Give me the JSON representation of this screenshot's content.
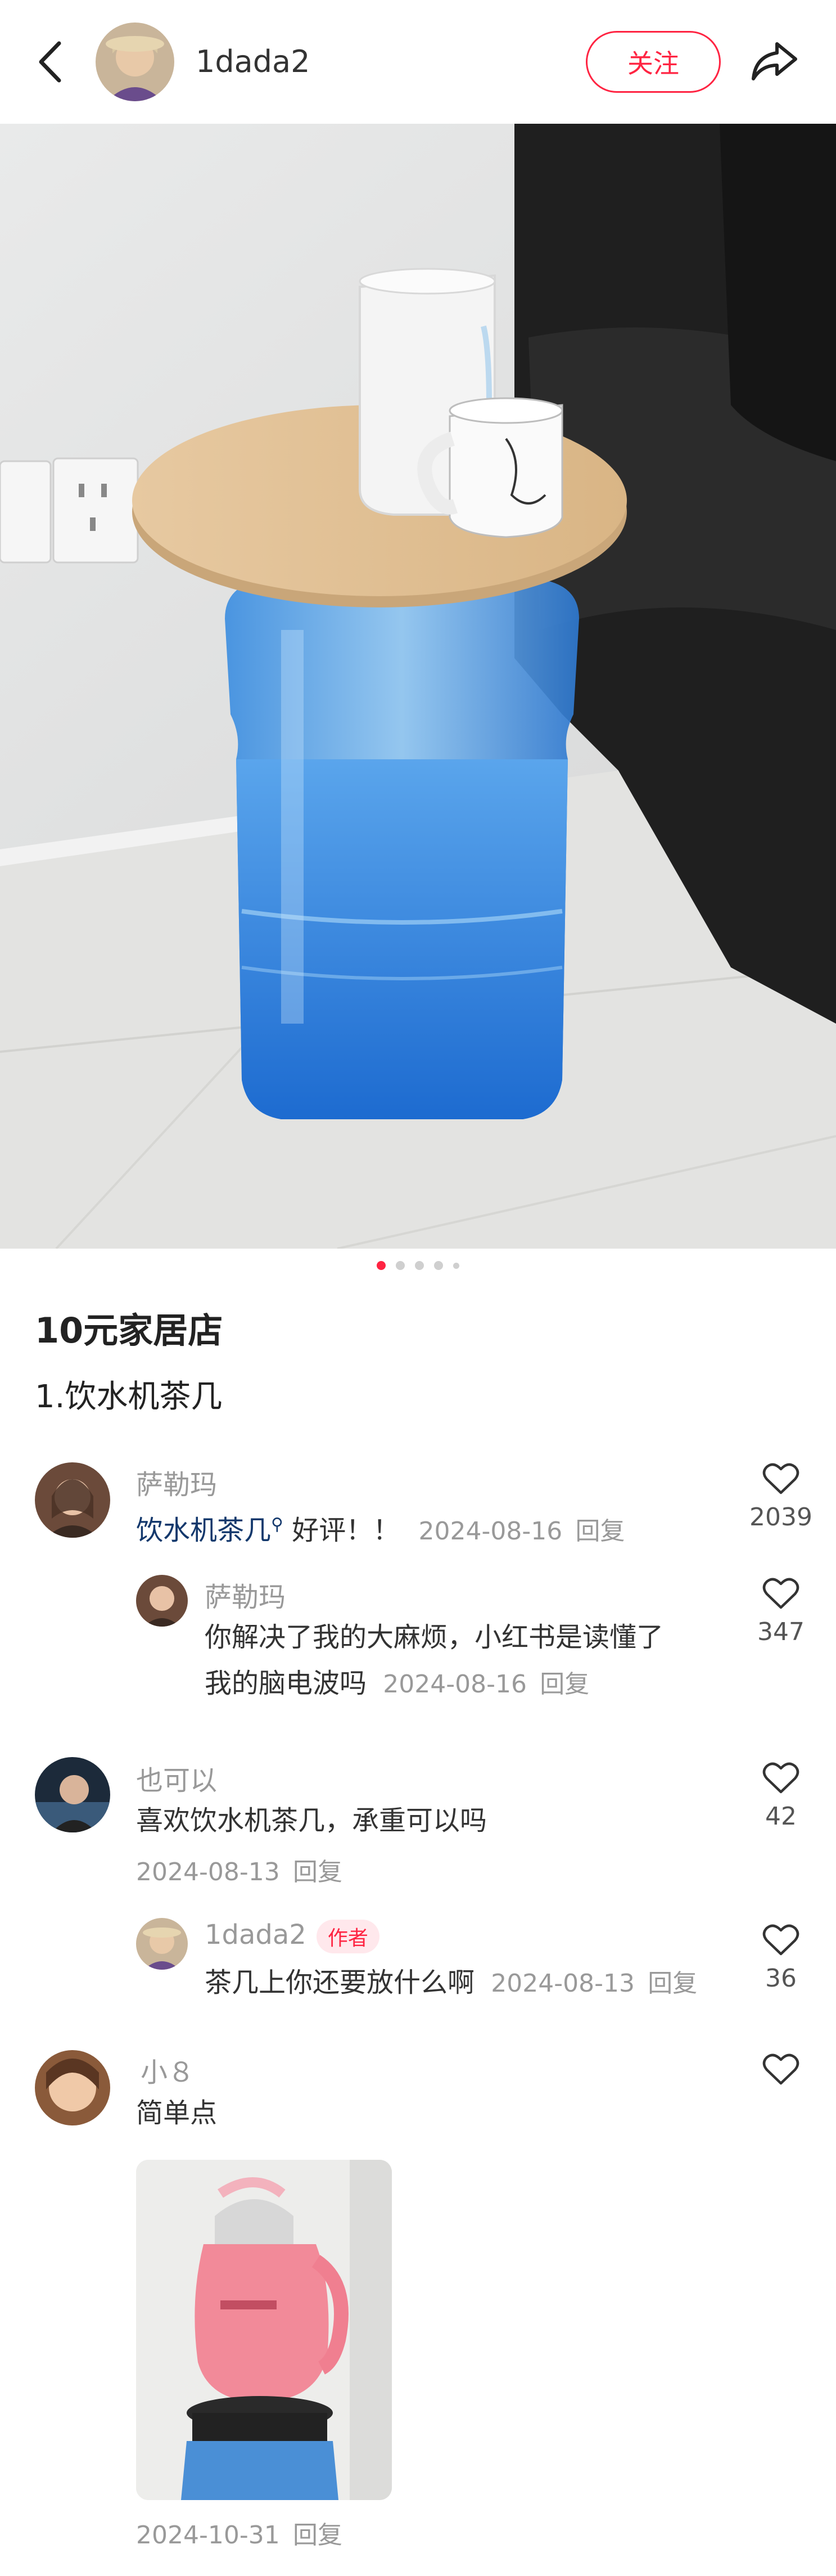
{
  "header": {
    "username": "1dada2",
    "follow_label": "关注",
    "back_icon": "back-arrow-icon",
    "share_icon": "share-icon"
  },
  "carousel": {
    "total_dots": 5,
    "active_index": 0
  },
  "post": {
    "title": "10元家居店",
    "body": "1.饮水机茶几"
  },
  "comments": [
    {
      "name": "萨勒玛",
      "link_text": "饮水机茶几",
      "text": " 好评！！",
      "date": "2024-08-16",
      "reply_label": "回复",
      "likes": "2039",
      "replies": [
        {
          "name": "萨勒玛",
          "line1": "你解决了我的大麻烦，小红书是读懂了",
          "line2": "我的脑电波吗",
          "date": "2024-08-16",
          "reply_label": "回复",
          "likes": "347"
        }
      ]
    },
    {
      "name": "也可以",
      "text": "喜欢饮水机茶几，承重可以吗",
      "date": "2024-08-13",
      "reply_label": "回复",
      "likes": "42",
      "replies": [
        {
          "name": "1dada2",
          "badge": "作者",
          "text": "茶几上你还要放什么啊",
          "date": "2024-08-13",
          "reply_label": "回复",
          "likes": "36"
        }
      ]
    },
    {
      "name": "小８",
      "text": "简单点",
      "date": "2024-10-31",
      "reply_label": "回复",
      "likes": ""
    }
  ],
  "colors": {
    "accent": "#ff2442",
    "link": "#13386c",
    "meta": "#999999"
  }
}
